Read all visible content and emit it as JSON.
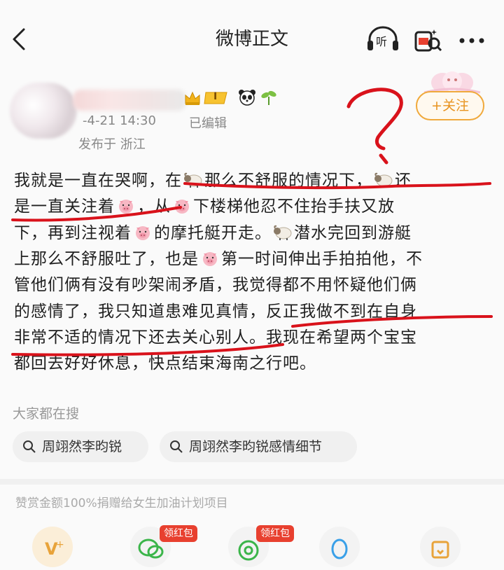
{
  "header": {
    "title": "微博正文",
    "listen_label": "听"
  },
  "author": {
    "datetime": "-4-21 14:30",
    "edited": "已编辑",
    "location": "发布于 浙江",
    "level_badge": "I",
    "follow_label": "+关注"
  },
  "post": {
    "lines": [
      "我就是一直在哭啊，在{sheep}那么不舒服的情况下，{sheep}还",
      "是一直关注着{pig}，从{pig}下楼梯他忍不住抬手扶又放",
      "下，再到注视着{pig}的摩托艇开走。{sheep}潜水完回到游艇",
      "上那么不舒服吐了，也是{pig}第一时间伸出手拍拍他，不",
      "管他们俩有没有吵架闹矛盾，我觉得都不用怀疑他们俩",
      "的感情了，我只知道患难见真情，反正我做不到在自身",
      "非常不适的情况下还去关心别人。我现在希望两个宝宝",
      "都回去好好休息，快点结束海南之行吧。"
    ]
  },
  "search": {
    "title": "大家都在搜",
    "chips": [
      "周翊然李昀锐",
      "周翊然李昀锐感情细节"
    ]
  },
  "reward": {
    "text": "赞赏金额100%捐赠给女生加油计划项目",
    "badge_label": "领红包"
  },
  "colors": {
    "annotation_red": "#d9121b",
    "follow_orange": "#e8931f",
    "badge_red": "#e8402f"
  }
}
